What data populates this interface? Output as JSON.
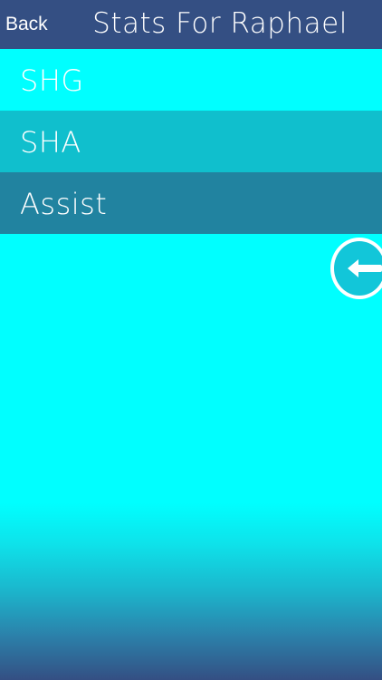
{
  "nav": {
    "back_label": "Back",
    "title": "Stats For Raphael",
    "background": "#344f83"
  },
  "stats": [
    {
      "label": "SHG",
      "color": "#00ffff"
    },
    {
      "label": "SHA",
      "color": "#10bfcd"
    },
    {
      "label": "Assist",
      "color": "#2183a0"
    }
  ],
  "floating_button": {
    "icon": "left-arrow-icon",
    "color": "#12c6d9",
    "border": "#ffffff"
  },
  "colors": {
    "background": "#00ffff",
    "gradient_bottom": "#344f83",
    "text": "#ffffff"
  }
}
